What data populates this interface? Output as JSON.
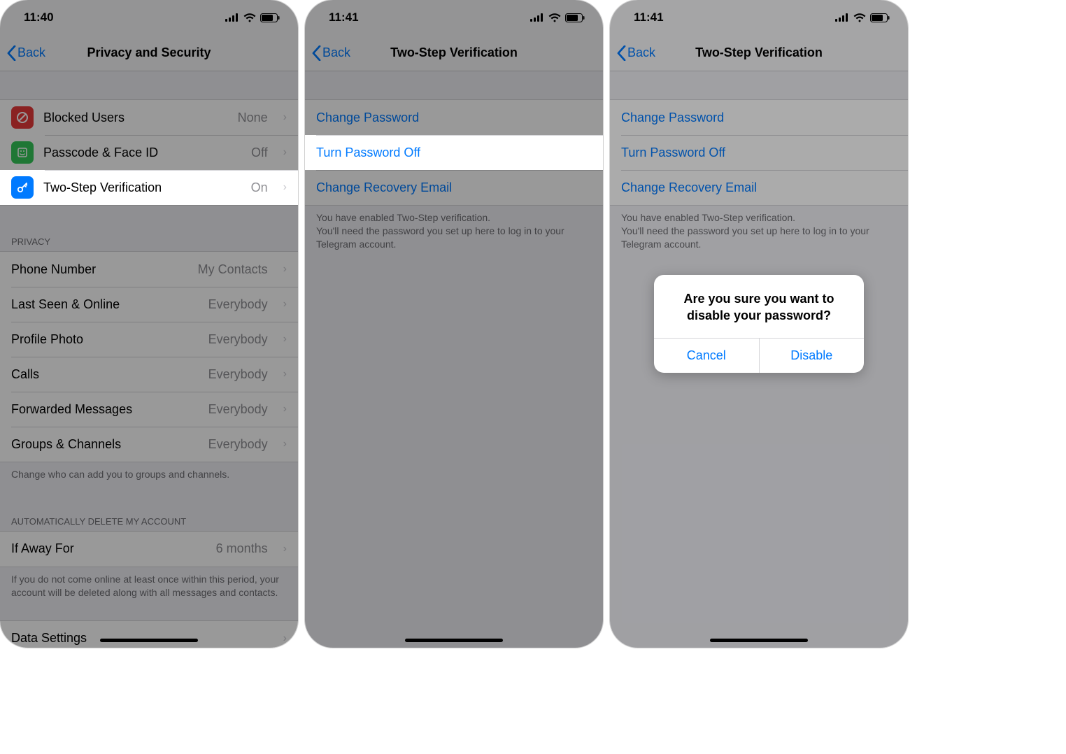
{
  "screen1": {
    "time": "11:40",
    "back": "Back",
    "title": "Privacy and Security",
    "rows_top": [
      {
        "icon": "blocked",
        "label": "Blocked Users",
        "value": "None"
      },
      {
        "icon": "passcode",
        "label": "Passcode & Face ID",
        "value": "Off"
      },
      {
        "icon": "key",
        "label": "Two-Step Verification",
        "value": "On"
      }
    ],
    "section_privacy_header": "Privacy",
    "privacy_rows": [
      {
        "label": "Phone Number",
        "value": "My Contacts"
      },
      {
        "label": "Last Seen & Online",
        "value": "Everybody"
      },
      {
        "label": "Profile Photo",
        "value": "Everybody"
      },
      {
        "label": "Calls",
        "value": "Everybody"
      },
      {
        "label": "Forwarded Messages",
        "value": "Everybody"
      },
      {
        "label": "Groups & Channels",
        "value": "Everybody"
      }
    ],
    "privacy_footer": "Change who can add you to groups and channels.",
    "section_auto_header": "Automatically Delete My Account",
    "auto_rows": [
      {
        "label": "If Away For",
        "value": "6 months"
      }
    ],
    "auto_footer": "If you do not come online at least once within this period, your account will be deleted along with all messages and contacts.",
    "data_settings_label": "Data Settings"
  },
  "screen2": {
    "time": "11:41",
    "back": "Back",
    "title": "Two-Step Verification",
    "rows": [
      {
        "label": "Change Password"
      },
      {
        "label": "Turn Password Off"
      },
      {
        "label": "Change Recovery Email"
      }
    ],
    "footer": "You have enabled Two-Step verification.\nYou'll need the password you set up here to log in to your Telegram account."
  },
  "screen3": {
    "time": "11:41",
    "back": "Back",
    "title": "Two-Step Verification",
    "rows": [
      {
        "label": "Change Password"
      },
      {
        "label": "Turn Password Off"
      },
      {
        "label": "Change Recovery Email"
      }
    ],
    "footer": "You have enabled Two-Step verification.\nYou'll need the password you set up here to log in to your Telegram account.",
    "alert": {
      "title": "Are you sure you want to disable your password?",
      "cancel": "Cancel",
      "confirm": "Disable"
    }
  }
}
